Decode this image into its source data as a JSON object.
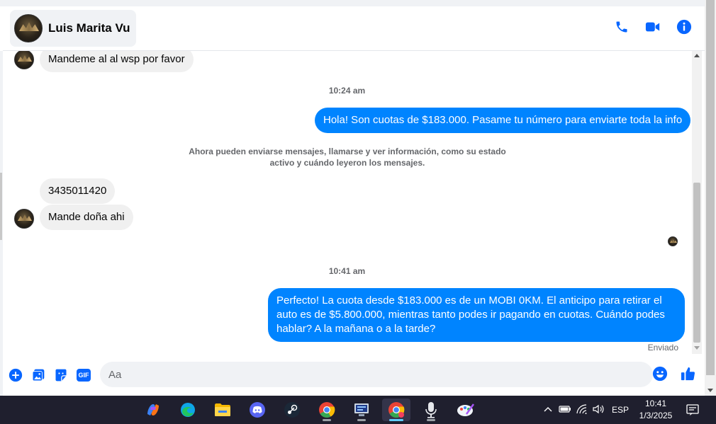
{
  "header": {
    "contact_name": "Luis Marita Vu",
    "icons": [
      "phone-icon",
      "video-camera-icon",
      "info-icon"
    ],
    "accent_color": "#0084ff"
  },
  "messages": [
    {
      "direction": "in",
      "text": "Mandeme al al wsp por favor"
    },
    {
      "direction": "time",
      "text": "10:24 am"
    },
    {
      "direction": "out",
      "text": "Hola! Son cuotas de $183.000. Pasame tu número para enviarte toda la info"
    },
    {
      "direction": "notice",
      "text": "Ahora pueden enviarse mensajes, llamarse y ver información, como su estado activo y cuándo leyeron los mensajes."
    },
    {
      "direction": "in",
      "text": "3435011420"
    },
    {
      "direction": "in",
      "text": "Mande doña ahi"
    },
    {
      "direction": "time",
      "text": "10:41 am"
    },
    {
      "direction": "out",
      "text": "Perfecto! La cuota desde $183.000 es de un MOBI 0KM. El anticipo para retirar el auto es de $5.800.000, mientras tanto podes ir pagando en cuotas. Cuándo podes hablar? A la mañana o a la tarde?"
    }
  ],
  "status": "Enviado",
  "composer": {
    "placeholder": "Aa",
    "gif_label": "GIF",
    "icons": [
      "plus-icon",
      "image-icon",
      "sticker-icon",
      "gif-icon",
      "emoji-icon",
      "thumbs-up-icon"
    ]
  },
  "taskbar": {
    "apps": [
      "copilot-icon",
      "edge-icon",
      "file-explorer-icon",
      "discord-icon",
      "steam-icon",
      "chrome-icon",
      "network-app-icon",
      "chrome-profile-icon",
      "microphone-app-icon",
      "paint-app-icon"
    ],
    "language": "ESP",
    "time": "10:41",
    "date": "1/3/2025"
  }
}
